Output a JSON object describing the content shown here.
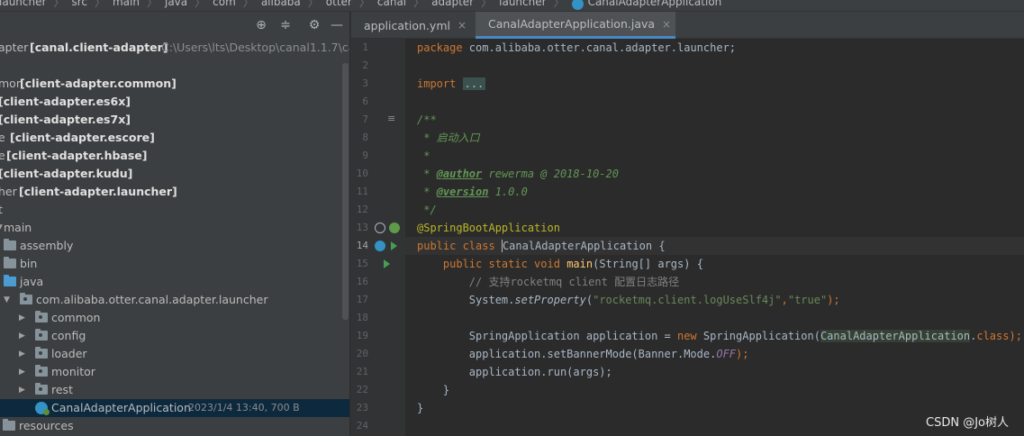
{
  "breadcrumb": [
    "launcher",
    "src",
    "main",
    "java",
    "com",
    "alibaba",
    "otter",
    "canal",
    "adapter",
    "launcher",
    "CanalAdapterApplication"
  ],
  "project_tree": [
    {
      "text": "apter",
      "bold": "[canal.client-adapter]",
      "path": "C:\\Users\\lts\\Desktop\\canal1.1.7\\cana"
    },
    {
      "text": "mon",
      "bold": "[client-adapter.common]"
    },
    {
      "text": "",
      "bold": "[client-adapter.es6x]"
    },
    {
      "text": "",
      "bold": "[client-adapter.es7x]"
    },
    {
      "text": "e",
      "bold": "[client-adapter.escore]"
    },
    {
      "text": "e",
      "bold": "[client-adapter.hbase]"
    },
    {
      "text": "",
      "bold": "[client-adapter.kudu]"
    },
    {
      "text": "her",
      "bold": "[client-adapter.launcher]"
    },
    {
      "text": "t"
    },
    {
      "text": "main"
    },
    {
      "text": "assembly"
    },
    {
      "text": "bin"
    },
    {
      "text": "java"
    },
    {
      "text": "com.alibaba.otter.canal.adapter.launcher"
    },
    {
      "text": "common"
    },
    {
      "text": "config"
    },
    {
      "text": "loader"
    },
    {
      "text": "monitor"
    },
    {
      "text": "rest"
    },
    {
      "text": "CanalAdapterApplication",
      "meta": "2023/1/4 13:40, 700 B"
    },
    {
      "text": "resources"
    }
  ],
  "tabs": [
    {
      "label": "application.yml",
      "close": "×"
    },
    {
      "label": "CanalAdapterApplication.java",
      "close": "×"
    }
  ],
  "line_numbers": [
    "1",
    "2",
    "3",
    "6",
    "7",
    "8",
    "9",
    "10",
    "11",
    "12",
    "13",
    "14",
    "15",
    "16",
    "17",
    "18",
    "19",
    "20",
    "21",
    "22",
    "23",
    "24"
  ],
  "code": {
    "l1_kw": "package",
    "l1_rest": " com.alibaba.otter.canal.adapter.launcher;",
    "l3_kw": "import",
    "l3_dots": "...",
    "l7": "/**",
    "l8": " * 启动入口",
    "l9": " *",
    "l10_pre": " * ",
    "l10_tag": "@author",
    "l10_rest": " rewerma @ 2018-10-20",
    "l11_pre": " * ",
    "l11_tag": "@version",
    "l11_rest": " 1.0.0",
    "l12": " */",
    "l13": "@SpringBootApplication",
    "l14_kw": "public class",
    "l14_name": "CanalAdapterApplication",
    "l14_rest": " {",
    "l15_kw": "    public static void",
    "l15_m": "main",
    "l15_rest": "(String[] args) {",
    "l16": "        // 支持rocketmq client 配置日志路径",
    "l17_a": "        System.",
    "l17_m": "setProperty",
    "l17_b": "(",
    "l17_s1": "\"rocketmq.client.logUseSlf4j\"",
    "l17_c": ",",
    "l17_s2": "\"true\"",
    "l17_d": ");",
    "l19_a": "        SpringApplication application = ",
    "l19_kw": "new",
    "l19_b": " SpringApplication(",
    "l19_hl": "CanalAdapterApplication",
    "l19_c": ".",
    "l19_kw2": "class",
    "l19_d": ");",
    "l20_a": "        application.setBannerMode(Banner.Mode.",
    "l20_f": "OFF",
    "l20_b": ");",
    "l21": "        application.run(args);",
    "l22": "    }",
    "l23": "}"
  },
  "watermark": "CSDN @Jo树人",
  "colors": {
    "keyword": "#cc7832",
    "annotation": "#bbb529",
    "comment": "#629755",
    "string": "#6a8759",
    "selection": "#0d293e"
  }
}
